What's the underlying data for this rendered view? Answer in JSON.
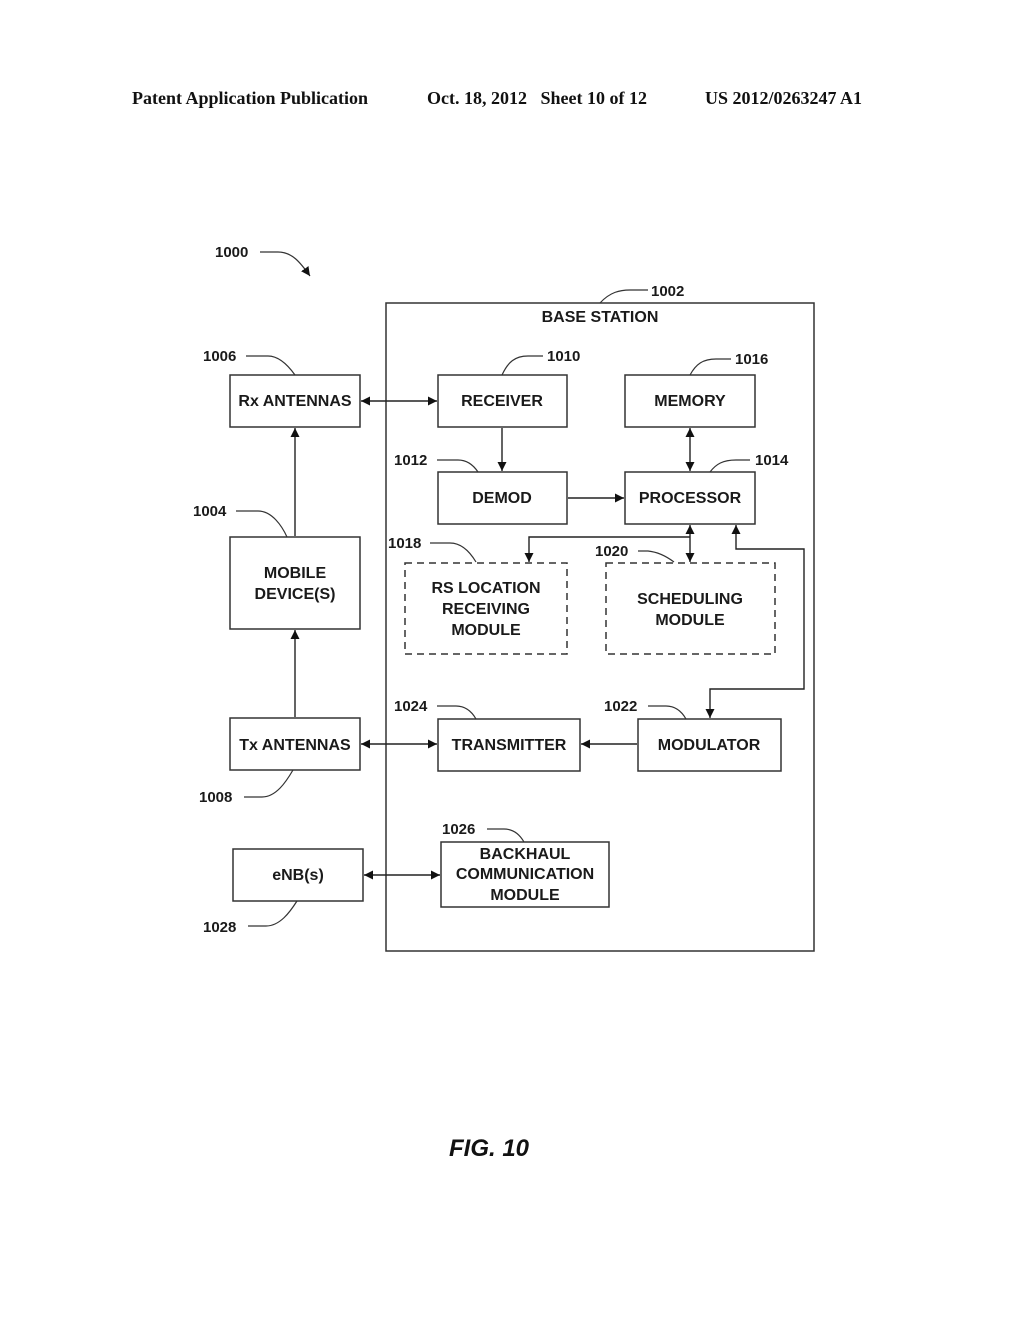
{
  "header": {
    "left": "Patent Application Publication",
    "date_sheet": "Oct. 18, 2012   Sheet 10 of 12",
    "number": "US 2012/0263247 A1"
  },
  "figure": {
    "ref": "1000",
    "caption": "FIG. 10"
  },
  "base_station": {
    "label": "BASE STATION",
    "ref": "1002"
  },
  "blocks": {
    "rx_antennas": {
      "label": "Rx ANTENNAS",
      "ref": "1006"
    },
    "mobile_devices": {
      "line1": "MOBILE",
      "line2": "DEVICE(S)",
      "ref": "1004"
    },
    "tx_antennas": {
      "label": "Tx ANTENNAS",
      "ref": "1008"
    },
    "enbs": {
      "label": "eNB(s)",
      "ref": "1028"
    },
    "receiver": {
      "label": "RECEIVER",
      "ref": "1010"
    },
    "memory": {
      "label": "MEMORY",
      "ref": "1016"
    },
    "demod": {
      "label": "DEMOD",
      "ref": "1012"
    },
    "processor": {
      "label": "PROCESSOR",
      "ref": "1014"
    },
    "rs_location": {
      "line1": "RS LOCATION",
      "line2": "RECEIVING",
      "line3": "MODULE",
      "ref": "1018"
    },
    "scheduling": {
      "line1": "SCHEDULING",
      "line2": "MODULE",
      "ref": "1020"
    },
    "transmitter": {
      "label": "TRANSMITTER",
      "ref": "1024"
    },
    "modulator": {
      "label": "MODULATOR",
      "ref": "1022"
    },
    "backhaul": {
      "line1": "BACKHAUL",
      "line2": "COMMUNICATION",
      "line3": "MODULE",
      "ref": "1026"
    }
  }
}
